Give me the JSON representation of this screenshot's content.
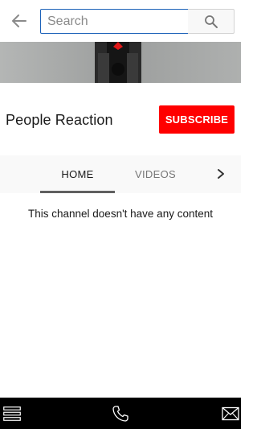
{
  "search": {
    "placeholder": "Search",
    "value": ""
  },
  "icons": {
    "back": "arrow-left-icon",
    "search": "magnifier-icon",
    "tabs_next": "chevron-right-icon",
    "menu": "hamburger-menu-icon",
    "phone": "phone-icon",
    "mail": "envelope-icon"
  },
  "channel": {
    "name": "People Reaction",
    "subscribe_label": "SUBSCRIBE"
  },
  "tabs": [
    {
      "label": "HOME",
      "active": true
    },
    {
      "label": "VIDEOS",
      "active": false
    }
  ],
  "content": {
    "empty_message": "This channel doesn't have any content"
  },
  "colors": {
    "subscribe": "#ff0000",
    "search_focus_border": "#1c62b9",
    "bottom_bar": "#000000"
  }
}
